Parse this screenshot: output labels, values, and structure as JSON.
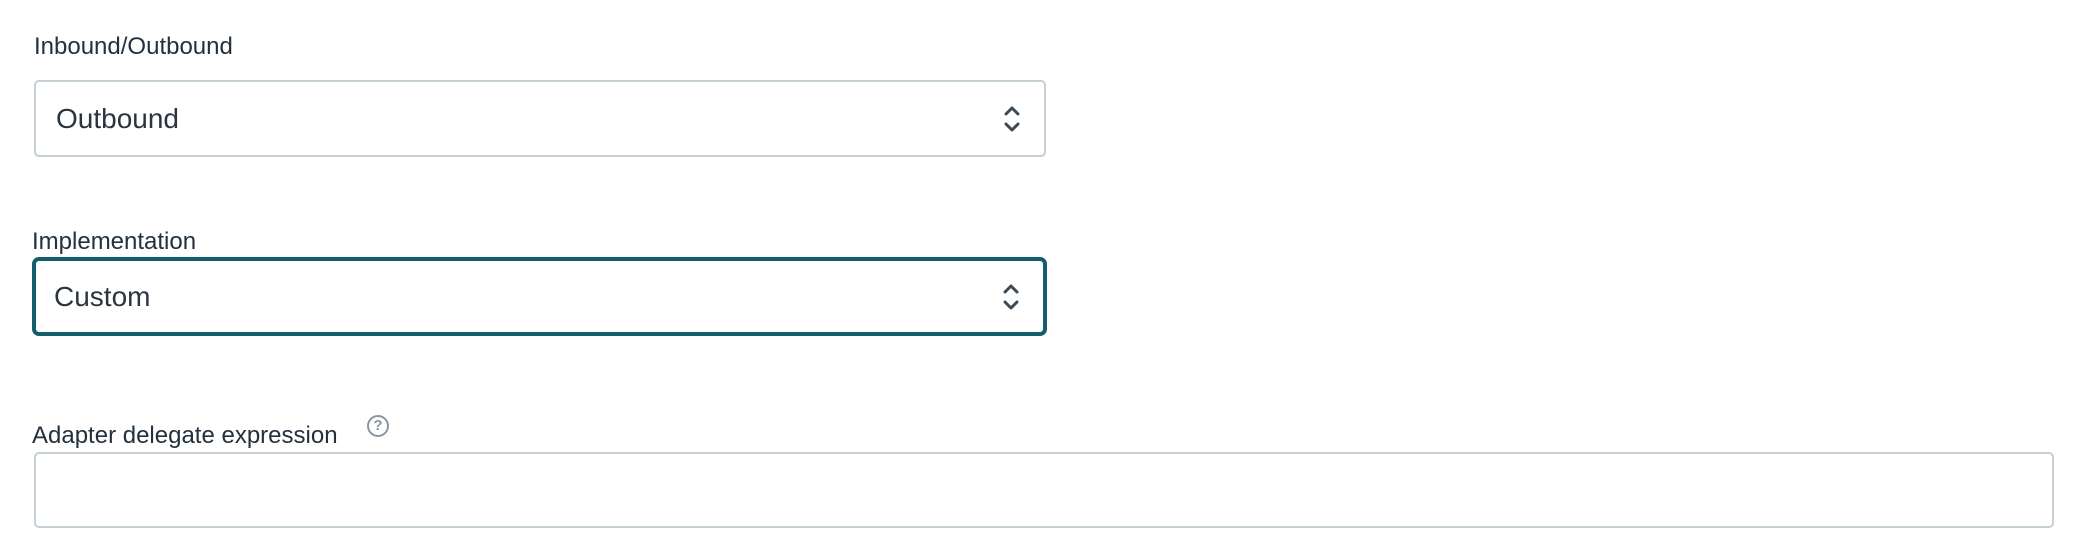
{
  "form": {
    "direction": {
      "label": "Inbound/Outbound",
      "value": "Outbound"
    },
    "implementation": {
      "label": "Implementation",
      "value": "Custom"
    },
    "adapter_delegate_expression": {
      "label": "Adapter delegate expression",
      "value": "",
      "help_icon": "question-circle-icon"
    }
  },
  "colors": {
    "focus_border": "#135e6b",
    "input_border": "#c5cfd6",
    "label_text": "#22313f"
  }
}
